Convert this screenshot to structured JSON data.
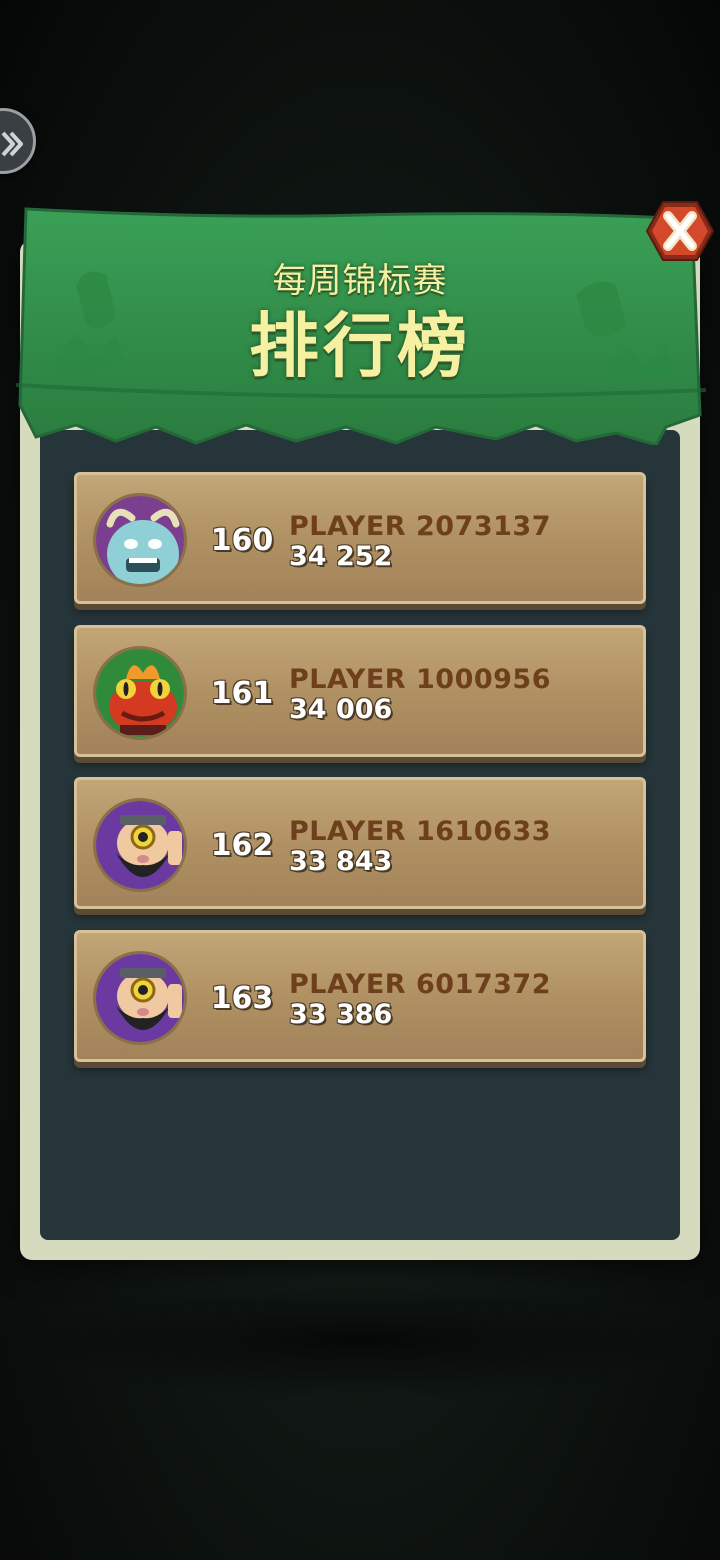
{
  "header": {
    "subtitle": "每周锦标赛",
    "title": "排行榜"
  },
  "colors": {
    "banner_green": "#2f8f4a",
    "title_yellow": "#f6f0a2",
    "close_orange": "#d2492b",
    "row_wood": "#b09163",
    "name_brown": "#6e3f1c"
  },
  "leaderboard": [
    {
      "rank": "160",
      "name": "PLAYER 2073137",
      "score": "34 252",
      "avatar": "yeti-avatar"
    },
    {
      "rank": "161",
      "name": "PLAYER 1000956",
      "score": "34 006",
      "avatar": "fire-frog-avatar"
    },
    {
      "rank": "162",
      "name": "PLAYER 1610633",
      "score": "33 843",
      "avatar": "dwarf-avatar"
    },
    {
      "rank": "163",
      "name": "PLAYER 6017372",
      "score": "33 386",
      "avatar": "dwarf-avatar"
    }
  ]
}
